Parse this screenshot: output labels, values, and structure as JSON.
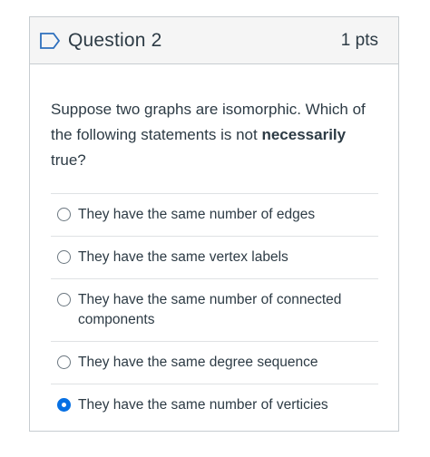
{
  "question": {
    "title": "Question 2",
    "points": "1 pts",
    "prompt_before": "Suppose two graphs are isomorphic.  Which of the following statements is not ",
    "prompt_bold": "necessarily",
    "prompt_after": " true?"
  },
  "answers": [
    {
      "label": "They have the same number of edges",
      "selected": false
    },
    {
      "label": "They have the same vertex labels",
      "selected": false
    },
    {
      "label": "They have the same number of connected components",
      "selected": false
    },
    {
      "label": "They have the same degree sequence",
      "selected": false
    },
    {
      "label": "They have the same number of verticies",
      "selected": true
    }
  ],
  "colors": {
    "selected": "#0770e3",
    "header_bg": "#f5f5f5",
    "border": "#c7cdd1",
    "text": "#2d3b45"
  },
  "icons": {
    "flag": "flag-outline-icon"
  }
}
